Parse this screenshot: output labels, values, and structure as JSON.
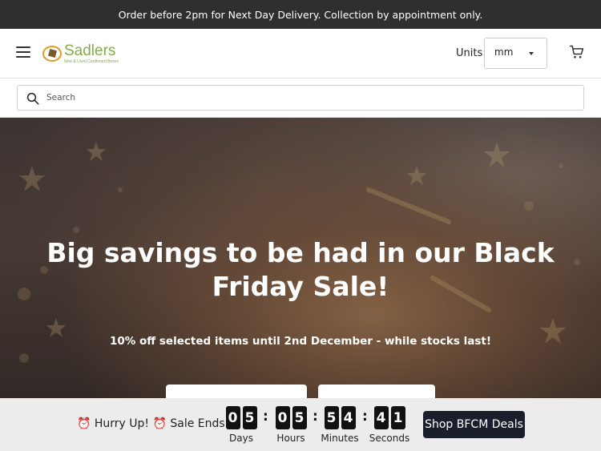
{
  "announcement": "Order before 2pm for Next Day Delivery. Collection by appointment only.",
  "header": {
    "logo_name": "Sadlers",
    "logo_tagline": "New & Used Cardboard Boxes",
    "units_label": "Units:",
    "units_value": "mm"
  },
  "search": {
    "placeholder": "Search"
  },
  "hero": {
    "title": "Big savings to be had in our Black Friday Sale!",
    "subtitle": "10% off selected items until 2nd December - while stocks last!"
  },
  "countdown": {
    "message": "⏰ Hurry Up! ⏰ Sale Ends in",
    "days": [
      "0",
      "5"
    ],
    "hours": [
      "0",
      "5"
    ],
    "minutes": [
      "5",
      "4"
    ],
    "seconds": [
      "4",
      "1"
    ],
    "labels": {
      "days": "Days",
      "hours": "Hours",
      "minutes": "Minutes",
      "seconds": "Seconds"
    },
    "separator": ":",
    "cta": "Shop BFCM Deals"
  },
  "colors": {
    "announcement_bg": "#2f2f2f",
    "logo_green": "#7fae44",
    "cta_bg": "#1b1f2b",
    "countdown_bg": "#ececec"
  }
}
